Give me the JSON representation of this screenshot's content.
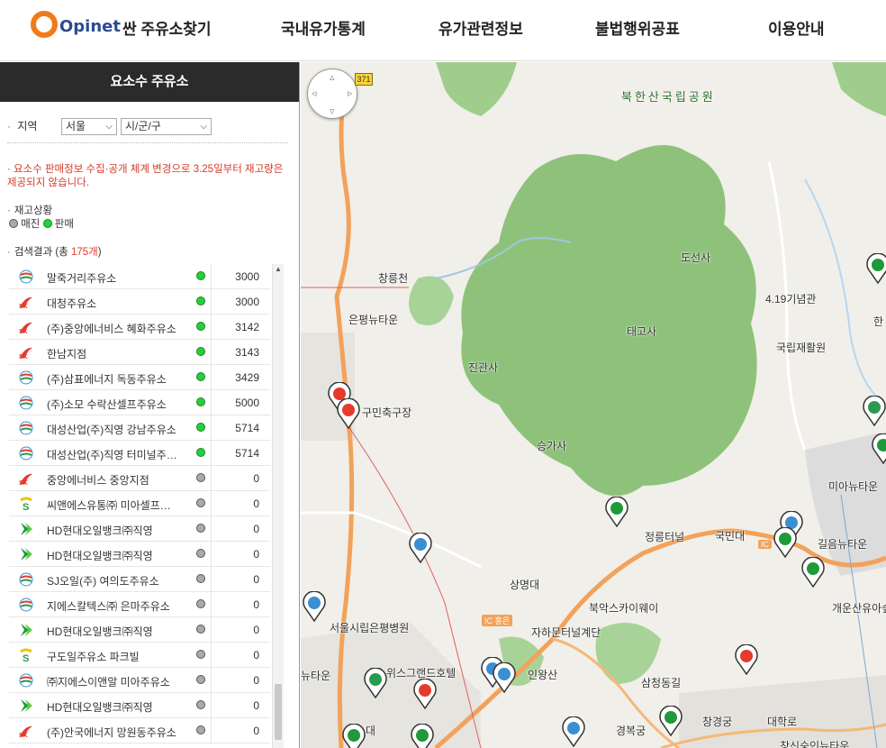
{
  "header": {
    "logo": "Opinet",
    "nav": [
      "싼 주유소찾기",
      "국내유가통계",
      "유가관련정보",
      "불법행위공표",
      "이용안내"
    ]
  },
  "panel": {
    "title": "요소수 주유소",
    "region_label": "지역",
    "region_select": "서울",
    "district_select": "시/군/구",
    "notice": "요소수 판매정보 수집·공개 체계 변경으로 3.25일부터 재고량은 제공되지 않습니다.",
    "stock_label": "재고상황",
    "legend_soldout": "매진",
    "legend_sale": "판매",
    "result_prefix": "검색결과 (총 ",
    "result_count": "175개",
    "result_suffix": ")"
  },
  "stations": [
    {
      "brand": "hyundai-oilbank-ex",
      "name": "말죽거리주유소",
      "status": "sale",
      "price": "3000"
    },
    {
      "brand": "sk",
      "name": "대청주유소",
      "status": "sale",
      "price": "3000"
    },
    {
      "brand": "sk",
      "name": "(주)중앙에너비스 혜화주유소",
      "status": "sale",
      "price": "3142"
    },
    {
      "brand": "sk",
      "name": "한남지점",
      "status": "sale",
      "price": "3143"
    },
    {
      "brand": "hyundai-oilbank-ex",
      "name": "(주)삼표에너지 독동주유소",
      "status": "sale",
      "price": "3429"
    },
    {
      "brand": "hyundai-oilbank-ex",
      "name": "(주)소모 수락산셀프주유소",
      "status": "sale",
      "price": "5000"
    },
    {
      "brand": "hyundai-oilbank-ex",
      "name": "대성산업(주)직영 강남주유소",
      "status": "sale",
      "price": "5714"
    },
    {
      "brand": "hyundai-oilbank-ex",
      "name": "대성산업(주)직영 터미널주유소",
      "status": "sale",
      "price": "5714"
    },
    {
      "brand": "sk",
      "name": "중앙에너비스 중앙지점",
      "status": "soldout",
      "price": "0"
    },
    {
      "brand": "s-oil",
      "name": "씨앤에스유통㈜ 미아셀프주유소",
      "status": "soldout",
      "price": "0"
    },
    {
      "brand": "hd-hyundai",
      "name": "HD현대오일뱅크㈜직영",
      "status": "soldout",
      "price": "0"
    },
    {
      "brand": "hd-hyundai",
      "name": "HD현대오일뱅크㈜직영",
      "status": "soldout",
      "price": "0"
    },
    {
      "brand": "hyundai-oilbank-ex",
      "name": "SJ오일(주) 여의도주유소",
      "status": "soldout",
      "price": "0"
    },
    {
      "brand": "hyundai-oilbank-ex",
      "name": "지에스칼텍스㈜ 은마주유소",
      "status": "soldout",
      "price": "0"
    },
    {
      "brand": "hd-hyundai",
      "name": "HD현대오일뱅크㈜직영",
      "status": "soldout",
      "price": "0"
    },
    {
      "brand": "s-oil",
      "name": "구도일주유소 파크빌",
      "status": "soldout",
      "price": "0"
    },
    {
      "brand": "hyundai-oilbank-ex",
      "name": "㈜지에스이앤알 미아주유소",
      "status": "soldout",
      "price": "0"
    },
    {
      "brand": "hd-hyundai",
      "name": "HD현대오일뱅크㈜직영",
      "status": "soldout",
      "price": "0"
    },
    {
      "brand": "sk",
      "name": "(주)안국에너지 망원동주유소",
      "status": "soldout",
      "price": "0"
    }
  ],
  "map": {
    "park_label": "북한산국립공원",
    "road_shield": "371",
    "labels": [
      {
        "text": "도선사"
      },
      {
        "text": "4.19기념관"
      },
      {
        "text": "창릉천"
      },
      {
        "text": "은평뉴타운"
      },
      {
        "text": "태고사"
      },
      {
        "text": "국립재활원"
      },
      {
        "text": "진관사"
      },
      {
        "text": "구민축구장"
      },
      {
        "text": "승가사"
      },
      {
        "text": "미아뉴타운"
      },
      {
        "text": "정릉터널"
      },
      {
        "text": "국민대"
      },
      {
        "text": "길음뉴타운"
      },
      {
        "text": "상명대"
      },
      {
        "text": "북악스카이웨이"
      },
      {
        "text": "개운산유아숲"
      },
      {
        "text": "서울시립은평병원"
      },
      {
        "text": "자하문터널계단"
      },
      {
        "text": "스위스그랜드호텔"
      },
      {
        "text": "인왕산"
      },
      {
        "text": "삼청동길"
      },
      {
        "text": "창경궁"
      },
      {
        "text": "경복궁"
      },
      {
        "text": "대학로"
      },
      {
        "text": "창신숭인뉴타운"
      },
      {
        "text": "뉴타운"
      },
      {
        "text": "한"
      },
      {
        "text": "대"
      }
    ],
    "ic_label": "IC",
    "ic_label2": "홍은"
  },
  "colors": {
    "accent_orange": "#f07a1c",
    "logo_blue": "#2a4c8f",
    "sale_green": "#1fd43a",
    "soldout_gray": "#aaaaaa",
    "notice_red": "#d33a2a",
    "park_green": "#8ec27a"
  }
}
